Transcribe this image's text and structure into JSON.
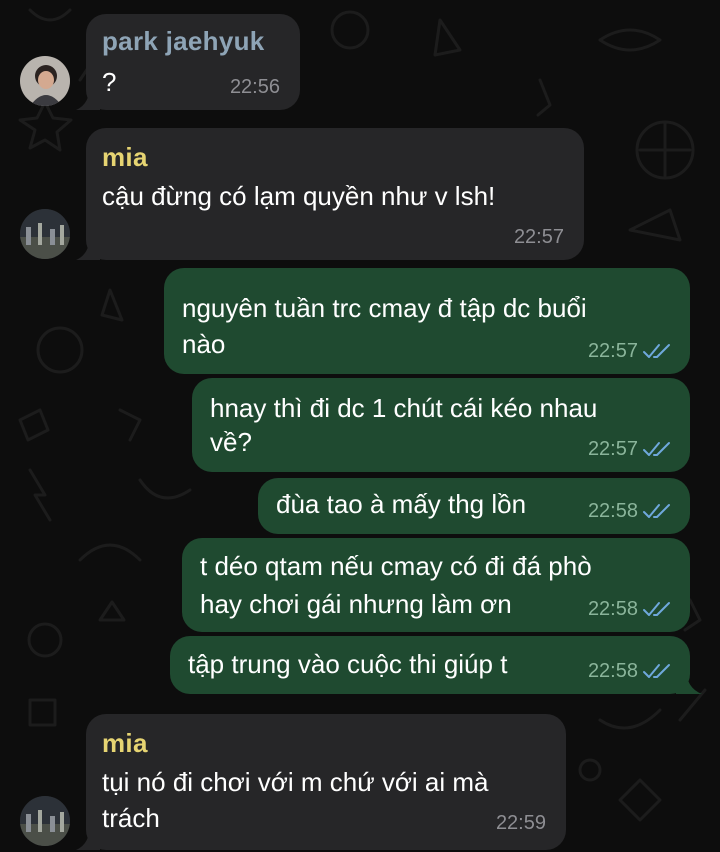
{
  "theme": {
    "background": "#0d0d0d",
    "incoming_bubble": "#262628",
    "outgoing_bubble": "#1f4a30",
    "read_tick_color": "#6fa8dc"
  },
  "messages": [
    {
      "direction": "incoming",
      "sender": "park jaehyuk",
      "sender_color": "#8ea4b6",
      "text": "?",
      "time": "22:56",
      "avatar": "avatar-photo"
    },
    {
      "direction": "incoming",
      "sender": "mia",
      "sender_color": "#e6d472",
      "text": "cậu đừng có lạm quyền như v lsh!",
      "time": "22:57",
      "avatar": "avatar-photo"
    },
    {
      "direction": "outgoing",
      "text_lines": [
        "nguyên tuần trc cmay đ tập dc buổi",
        "nào"
      ],
      "time": "22:57",
      "status": "read-double-check-icon"
    },
    {
      "direction": "outgoing",
      "text_lines": [
        "hnay thì đi dc 1 chút cái kéo nhau",
        "về?"
      ],
      "time": "22:57",
      "status": "read-double-check-icon"
    },
    {
      "direction": "outgoing",
      "text": "đùa tao à mấy thg lồn",
      "time": "22:58",
      "status": "read-double-check-icon"
    },
    {
      "direction": "outgoing",
      "text_lines": [
        "t déo qtam nếu cmay có đi đá phò",
        "hay chơi gái nhưng làm ơn"
      ],
      "time": "22:58",
      "status": "read-double-check-icon"
    },
    {
      "direction": "outgoing",
      "text": "tập trung vào cuộc thi giúp t",
      "time": "22:58",
      "status": "read-double-check-icon"
    },
    {
      "direction": "incoming",
      "sender": "mia",
      "sender_color": "#e6d472",
      "text_lines": [
        "tụi nó đi chơi với m chứ với ai mà",
        "trách"
      ],
      "time": "22:59",
      "avatar": "avatar-photo"
    }
  ]
}
